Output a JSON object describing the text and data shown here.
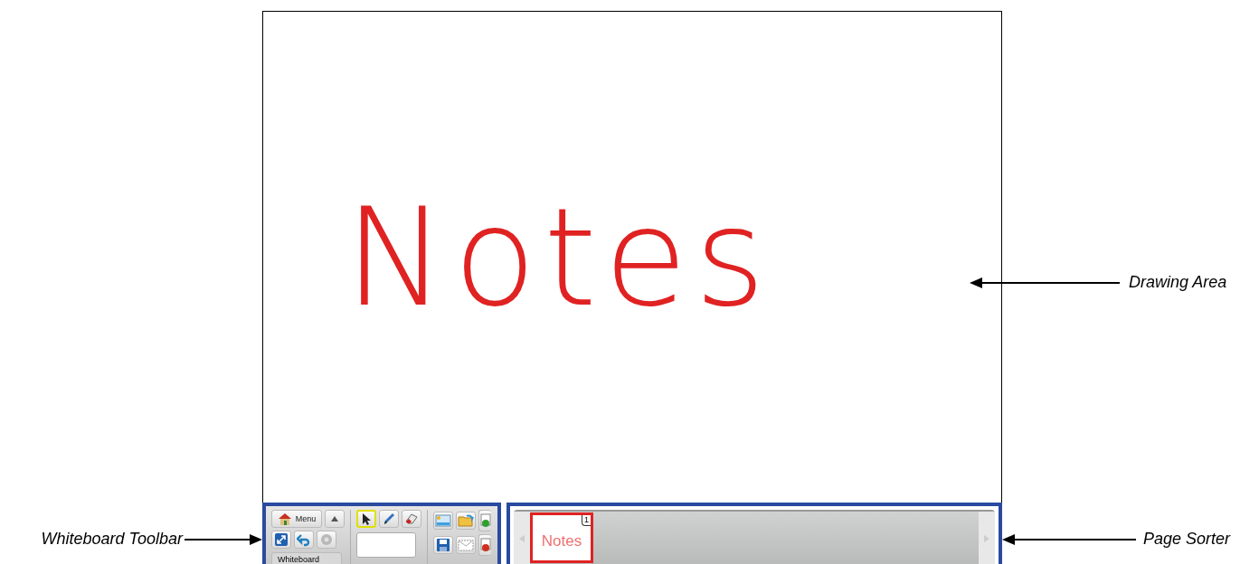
{
  "drawing_area": {
    "ink_text": "Notes"
  },
  "toolbar": {
    "menu_button": "Menu",
    "tab_label": "Whiteboard",
    "tools": [
      {
        "kind": "select",
        "selected": true
      },
      {
        "kind": "pen",
        "selected": false
      },
      {
        "kind": "eraser",
        "selected": false
      }
    ]
  },
  "page_sorter": {
    "pages": [
      {
        "number": "1",
        "thumbnail_text": "Notes",
        "selected": true
      }
    ]
  },
  "callouts": [
    {
      "kind": "drawing",
      "label": "Drawing Area"
    },
    {
      "kind": "toolbar",
      "label": "Whiteboard Toolbar"
    },
    {
      "kind": "sorter",
      "label": "Page Sorter"
    }
  ]
}
